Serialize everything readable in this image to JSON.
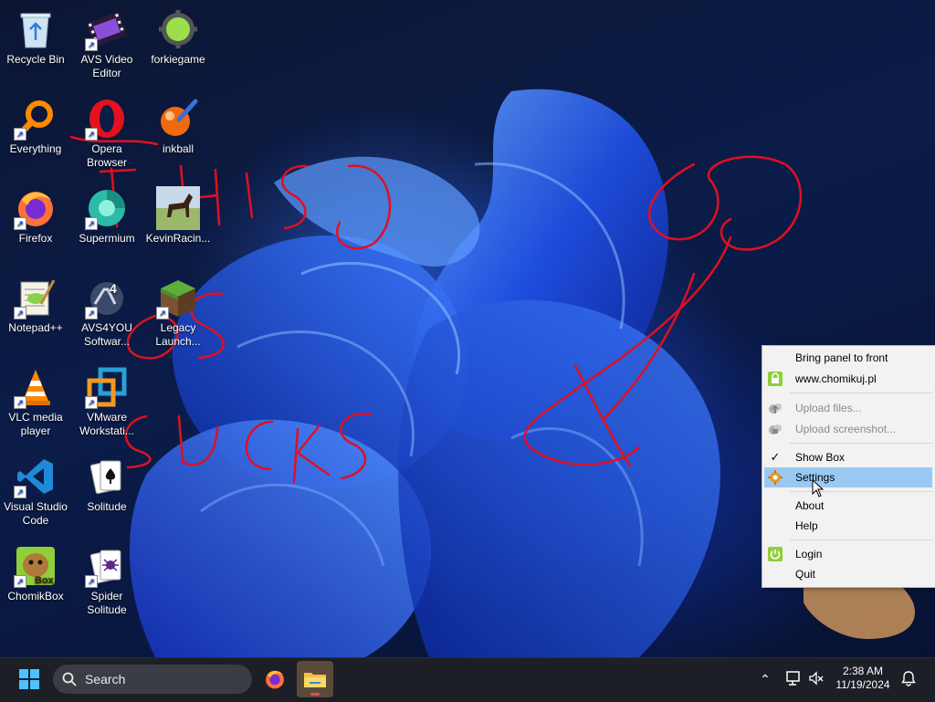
{
  "desktop_icons": [
    {
      "label": "Recycle Bin",
      "icon": "recycle-bin-icon"
    },
    {
      "label": "AVS Video Editor",
      "icon": "film-strip-icon"
    },
    {
      "label": "forkiegame",
      "icon": "green-ball-icon"
    },
    {
      "label": "Everything",
      "icon": "magnifier-icon"
    },
    {
      "label": "Opera Browser",
      "icon": "opera-icon"
    },
    {
      "label": "inkball",
      "icon": "inkball-icon"
    },
    {
      "label": "Firefox",
      "icon": "firefox-icon"
    },
    {
      "label": "Supermium",
      "icon": "supermium-icon"
    },
    {
      "label": "KevinRacin...",
      "icon": "horse-icon"
    },
    {
      "label": "Notepad++",
      "icon": "notepad-icon"
    },
    {
      "label": "AVS4YOU Softwar...",
      "icon": "avs4you-icon"
    },
    {
      "label": "Legacy Launch...",
      "icon": "grass-block-icon"
    },
    {
      "label": "VLC media player",
      "icon": "vlc-cone-icon"
    },
    {
      "label": "VMware Workstati...",
      "icon": "vmware-icon"
    },
    {
      "label": "Visual Studio Code",
      "icon": "vscode-icon"
    },
    {
      "label": "Solitude",
      "icon": "cards-icon"
    },
    {
      "label": "ChomikBox",
      "icon": "hamster-icon"
    },
    {
      "label": "Spider Solitude",
      "icon": "spider-cards-icon"
    }
  ],
  "context_menu": {
    "items": [
      {
        "label": "Bring panel to front",
        "enabled": true
      },
      {
        "label": "www.chomikuj.pl",
        "enabled": true,
        "icon": "lock-icon"
      },
      {
        "label": "Upload files...",
        "enabled": false,
        "icon": "upload-icon"
      },
      {
        "label": "Upload screenshot...",
        "enabled": false,
        "icon": "screenshot-icon"
      },
      {
        "label": "Show Box",
        "enabled": true,
        "checked": true
      },
      {
        "label": "Settings",
        "enabled": true,
        "highlighted": true,
        "icon": "gear-icon"
      },
      {
        "label": "About",
        "enabled": true
      },
      {
        "label": "Help",
        "enabled": true
      },
      {
        "label": "Login",
        "enabled": true,
        "icon": "power-icon"
      },
      {
        "label": "Quit",
        "enabled": true
      }
    ]
  },
  "taskbar": {
    "search_placeholder": "Search",
    "pinned": [
      "firefox-icon",
      "file-explorer-icon"
    ],
    "time": "2:38 AM",
    "date": "11/19/2024"
  },
  "colors": {
    "menu_highlight": "#99c9f2",
    "taskbar": "#1c1f26",
    "scribble": "#e01020"
  }
}
